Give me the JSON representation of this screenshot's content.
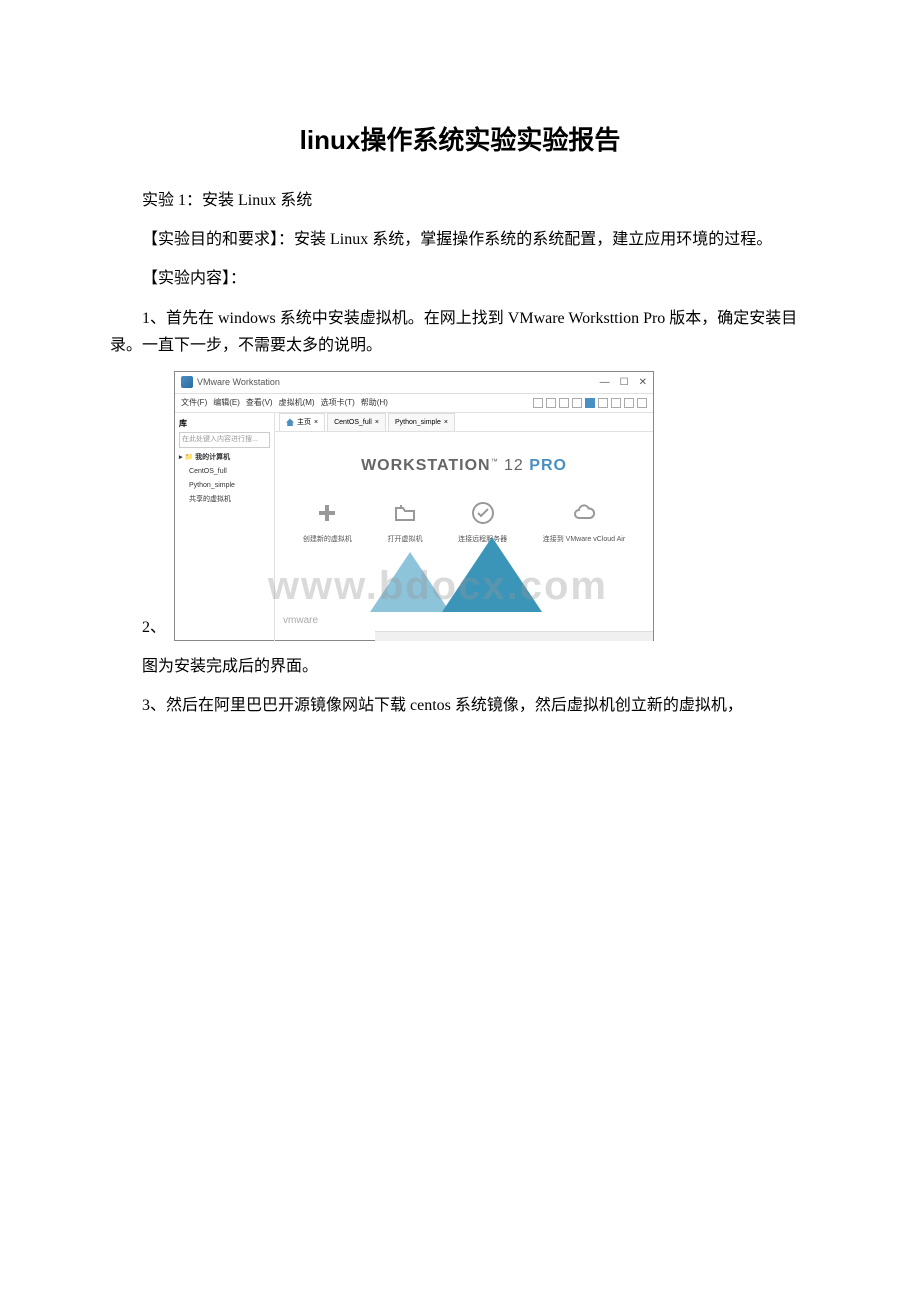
{
  "doc": {
    "title": "linux操作系统实验实验报告",
    "p1": "实验 1：安装 Linux 系统",
    "p2": "【实验目的和要求】：安装 Linux 系统，掌握操作系统的系统配置，建立应用环境的过程。",
    "p3": "【实验内容】：",
    "p4": "1、首先在 windows 系统中安装虚拟机。在网上找到 VMware Worksttion Pro 版本，确定安装目录。一直下一步，不需要太多的说明。",
    "p5_prefix": "2、",
    "p6": "图为安装完成后的界面。",
    "p7": "3、然后在阿里巴巴开源镜像网站下载 centos 系统镜像，然后虚拟机创立新的虚拟机，"
  },
  "vmware": {
    "window_title": "VMware Workstation",
    "menu": {
      "file": "文件(F)",
      "edit": "编辑(E)",
      "view": "查看(V)",
      "vm": "虚拟机(M)",
      "tabs": "选项卡(T)",
      "help": "帮助(H)"
    },
    "win_controls": {
      "min": "—",
      "max": "☐",
      "close": "✕"
    },
    "sidebar": {
      "library_label": "库",
      "close": "×",
      "search_placeholder": "在此处键入内容进行搜...",
      "root": "我的计算机",
      "items": [
        "CentOS_full",
        "Python_simple",
        "共享的虚拟机"
      ]
    },
    "tabs": {
      "home": "主页",
      "tab1": "CentOS_full",
      "tab2": "Python_simple"
    },
    "main": {
      "brand_prefix": "WORKSTATION",
      "brand_tm": "™",
      "brand_ver": " 12 ",
      "brand_pro": "PRO",
      "actions": {
        "create": "创建新的虚拟机",
        "open": "打开虚拟机",
        "connect_remote": "连接远程服务器",
        "connect_vcloud": "连接到 VMware vCloud Air"
      },
      "footer": "vmware"
    }
  },
  "watermark": "www.bdocx.com"
}
